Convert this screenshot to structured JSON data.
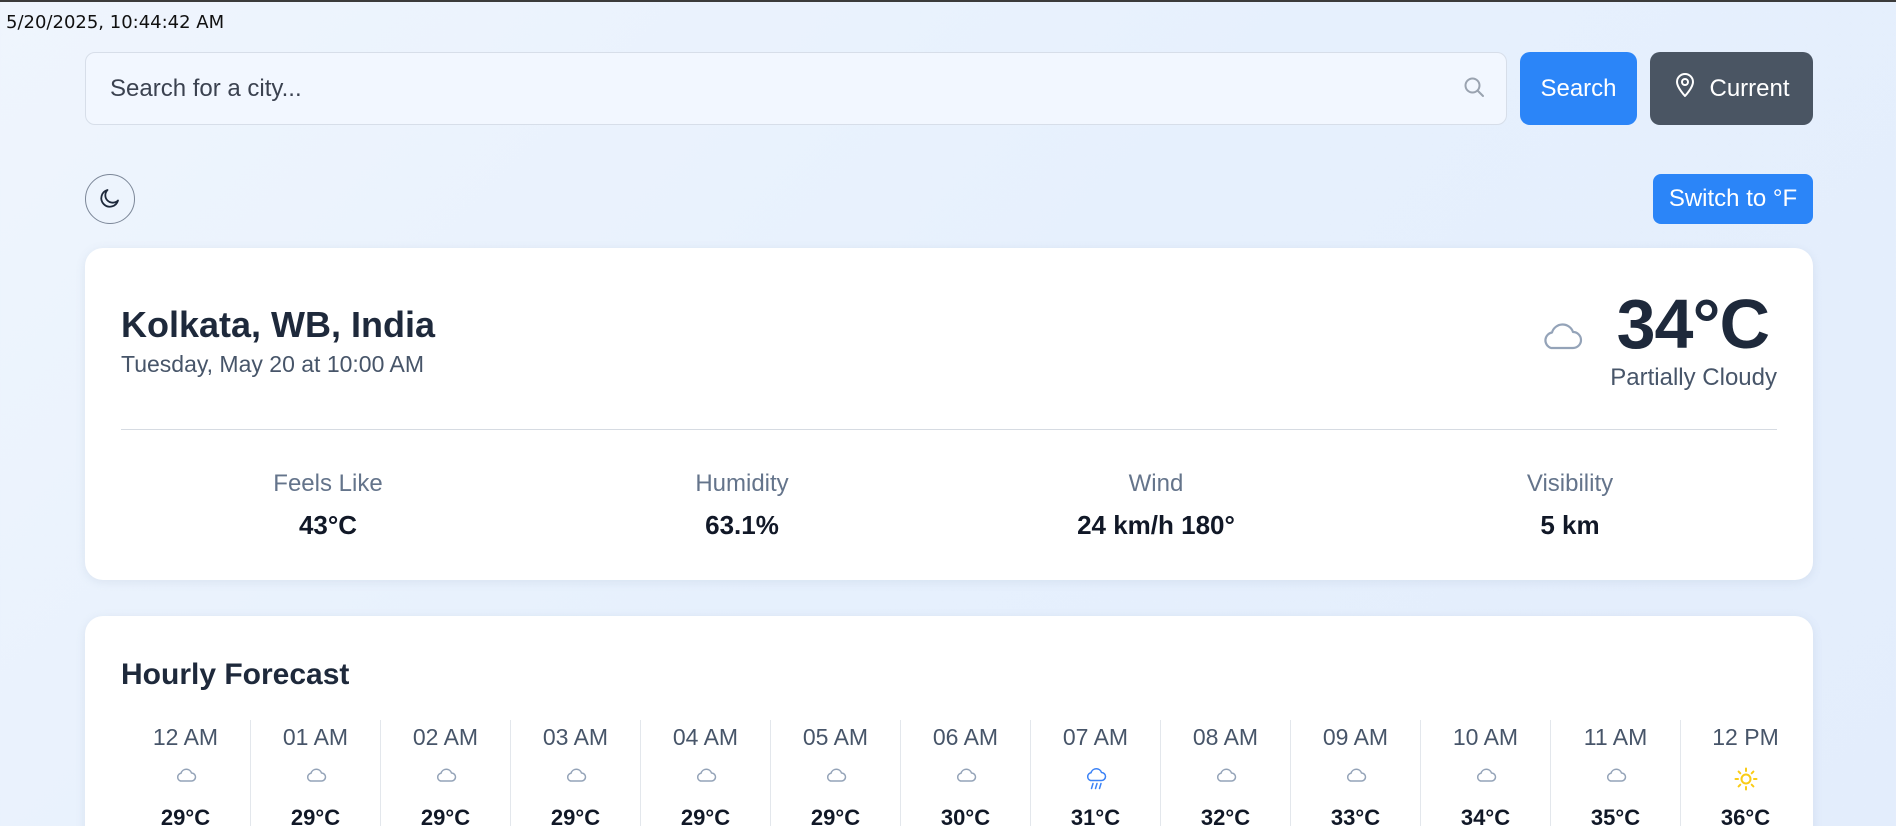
{
  "timestamp": "5/20/2025, 10:44:42 AM",
  "search": {
    "placeholder": "Search for a city...",
    "value": ""
  },
  "buttons": {
    "search": "Search",
    "current": "Current",
    "unit_toggle": "Switch to °F"
  },
  "current": {
    "location": "Kolkata, WB, India",
    "datetime": "Tuesday, May 20 at 10:00 AM",
    "temperature": "34°C",
    "condition": "Partially Cloudy",
    "condition_icon": "cloud-icon",
    "stats": [
      {
        "label": "Feels Like",
        "value": "43°C"
      },
      {
        "label": "Humidity",
        "value": "63.1%"
      },
      {
        "label": "Wind",
        "value": "24 km/h 180°"
      },
      {
        "label": "Visibility",
        "value": "5 km"
      }
    ]
  },
  "forecast": {
    "title": "Hourly Forecast",
    "hours": [
      {
        "time": "12 AM",
        "icon": "cloud-icon",
        "temp": "29°C"
      },
      {
        "time": "01 AM",
        "icon": "cloud-icon",
        "temp": "29°C"
      },
      {
        "time": "02 AM",
        "icon": "cloud-icon",
        "temp": "29°C"
      },
      {
        "time": "03 AM",
        "icon": "cloud-icon",
        "temp": "29°C"
      },
      {
        "time": "04 AM",
        "icon": "cloud-icon",
        "temp": "29°C"
      },
      {
        "time": "05 AM",
        "icon": "cloud-icon",
        "temp": "29°C"
      },
      {
        "time": "06 AM",
        "icon": "cloud-icon",
        "temp": "30°C"
      },
      {
        "time": "07 AM",
        "icon": "rain-cloud-icon",
        "temp": "31°C"
      },
      {
        "time": "08 AM",
        "icon": "cloud-icon",
        "temp": "32°C"
      },
      {
        "time": "09 AM",
        "icon": "cloud-icon",
        "temp": "33°C"
      },
      {
        "time": "10 AM",
        "icon": "cloud-icon",
        "temp": "34°C"
      },
      {
        "time": "11 AM",
        "icon": "cloud-icon",
        "temp": "35°C"
      },
      {
        "time": "12 PM",
        "icon": "sun-icon",
        "temp": "36°C"
      }
    ]
  },
  "colors": {
    "primary": "#2b85f8",
    "secondary": "#4a5563",
    "rain_icon": "#3b82f6",
    "sun_icon": "#facc15",
    "cloud_icon": "#94a3b8"
  }
}
